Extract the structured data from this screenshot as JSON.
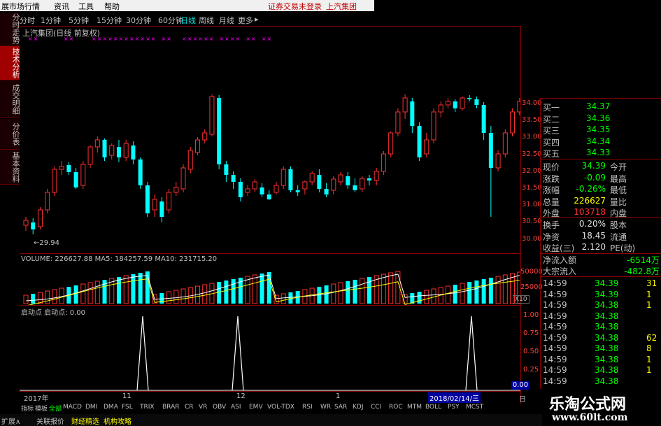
{
  "menu": {
    "items": [
      "展市场行情",
      "资讯",
      "工具",
      "帮助"
    ],
    "notice": "证券交易未登录",
    "stock": "上汽集团"
  },
  "periods": [
    "分时",
    "1分钟",
    "5分钟",
    "15分钟",
    "30分钟",
    "60分钟",
    "日线",
    "周线",
    "月线",
    "更多"
  ],
  "active_period": "日线",
  "side_tabs": [
    "分时走势",
    "技术分析",
    "成交明细",
    "分价表",
    "基本资料"
  ],
  "stock_title": "上汽集团(日线 前复权)",
  "main_chart": {
    "yticks": [
      "34.00",
      "33.50",
      "33.00",
      "32.50",
      "32.00",
      "31.50",
      "31.00",
      "30.50",
      "30.00"
    ],
    "low_label": "29.94"
  },
  "volume": {
    "label": "VOLUME: 226627.88  MA5: 184257.59  MA10: 231715.20",
    "yticks": [
      "50000",
      "25000"
    ],
    "unit": "X10"
  },
  "indicator": {
    "label": "启动点  启动点: 0.00",
    "yticks": [
      "1.00",
      "0.75",
      "0.50",
      "0.25",
      "0.00"
    ],
    "zero_box": "0.00"
  },
  "date_axis": {
    "start": "2017年",
    "m1": "11",
    "m2": "12",
    "m3": "1",
    "cursor": "2018/02/14/三"
  },
  "quote": {
    "bids": [
      {
        "label": "买一",
        "price": "34.37"
      },
      {
        "label": "买二",
        "price": "34.36"
      },
      {
        "label": "买三",
        "price": "34.35"
      },
      {
        "label": "买四",
        "price": "34.34"
      },
      {
        "label": "买五",
        "price": "34.33"
      }
    ],
    "rows": [
      {
        "l1": "现价",
        "v1": "34.39",
        "l2": "今开"
      },
      {
        "l1": "涨跌",
        "v1": "-0.09",
        "l2": "最高"
      },
      {
        "l1": "涨幅",
        "v1": "-0.26%",
        "l2": "最低"
      },
      {
        "l1": "总量",
        "v1": "226627",
        "l2": "量比"
      },
      {
        "l1": "外盘",
        "v1": "103718",
        "l2": "内盘"
      }
    ],
    "rows2": [
      {
        "l1": "换手",
        "v1": "0.20%",
        "l2": "股本"
      },
      {
        "l1": "净资",
        "v1": "18.45",
        "l2": "流通"
      },
      {
        "l1": "收益(三)",
        "v1": "2.120",
        "l2": "PE(动)"
      }
    ],
    "flow": [
      {
        "label": "净流入额",
        "value": "-6514万"
      },
      {
        "label": "大宗流入",
        "value": "-482.8万"
      }
    ],
    "ticks": [
      {
        "time": "14:59",
        "price": "34.39",
        "vol": "31"
      },
      {
        "time": "14:59",
        "price": "34.39",
        "vol": "1"
      },
      {
        "time": "14:59",
        "price": "34.38",
        "vol": "1"
      },
      {
        "time": "14:59",
        "price": "34.38",
        "vol": ""
      },
      {
        "time": "14:59",
        "price": "34.38",
        "vol": ""
      },
      {
        "time": "14:59",
        "price": "34.38",
        "vol": "62"
      },
      {
        "time": "14:59",
        "price": "34.38",
        "vol": "8"
      },
      {
        "time": "14:59",
        "price": "34.38",
        "vol": "1"
      },
      {
        "time": "14:59",
        "price": "34.38",
        "vol": "1"
      },
      {
        "time": "14:59",
        "price": "34.38",
        "vol": ""
      }
    ]
  },
  "indicator_tabs": [
    "指标",
    "模板",
    "全部",
    "MACD",
    "DMI",
    "DMA",
    "FSL",
    "TRIX",
    "BRAR",
    "CR",
    "VR",
    "OBV",
    "ASI",
    "EMV",
    "VOL-TDX",
    "RSI",
    "WR",
    "SAR",
    "KDJ",
    "CCI",
    "ROC",
    "MTM",
    "BOLL",
    "PSY",
    "MCST"
  ],
  "selected_indicator_tab": "全部",
  "bottom_tabs": [
    "扩展∧",
    "关联报价",
    "财经精选",
    "机构攻略"
  ],
  "day_label": "日",
  "watermark": {
    "title": "乐淘公式网",
    "url": "www.60lt.com"
  },
  "colors": {
    "up": "#ff3030",
    "down": "#00ffff",
    "grid": "#8c0000",
    "text": "#c0c0c0"
  }
}
